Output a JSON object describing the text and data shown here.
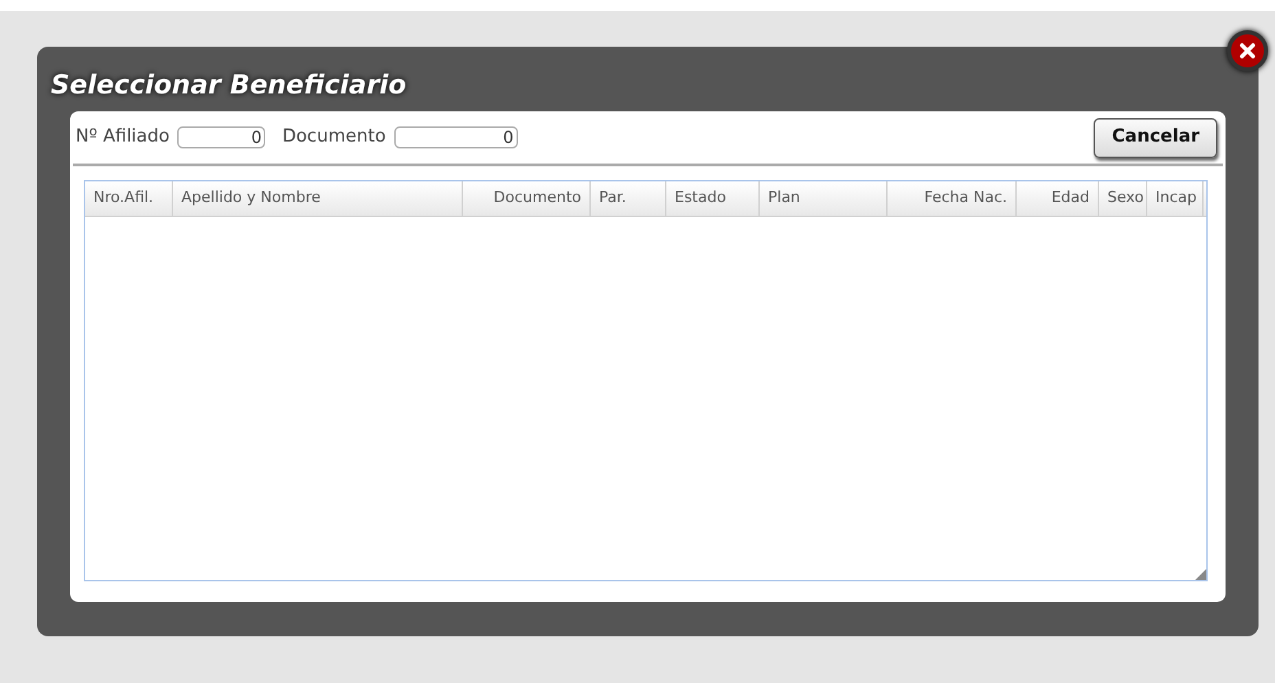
{
  "dialog": {
    "title": "Seleccionar Beneficiario"
  },
  "filters": [
    {
      "label": "Nº Afiliado",
      "value": "0"
    },
    {
      "label": "Documento",
      "value": "0"
    }
  ],
  "cancel_button": "Cancelar",
  "table": {
    "columns": [
      "Nro.Afil.",
      "Apellido y Nombre",
      "Documento",
      "Par.",
      "Estado",
      "Plan",
      "Fecha Nac.",
      "Edad",
      "Sexo",
      "Incap"
    ]
  }
}
